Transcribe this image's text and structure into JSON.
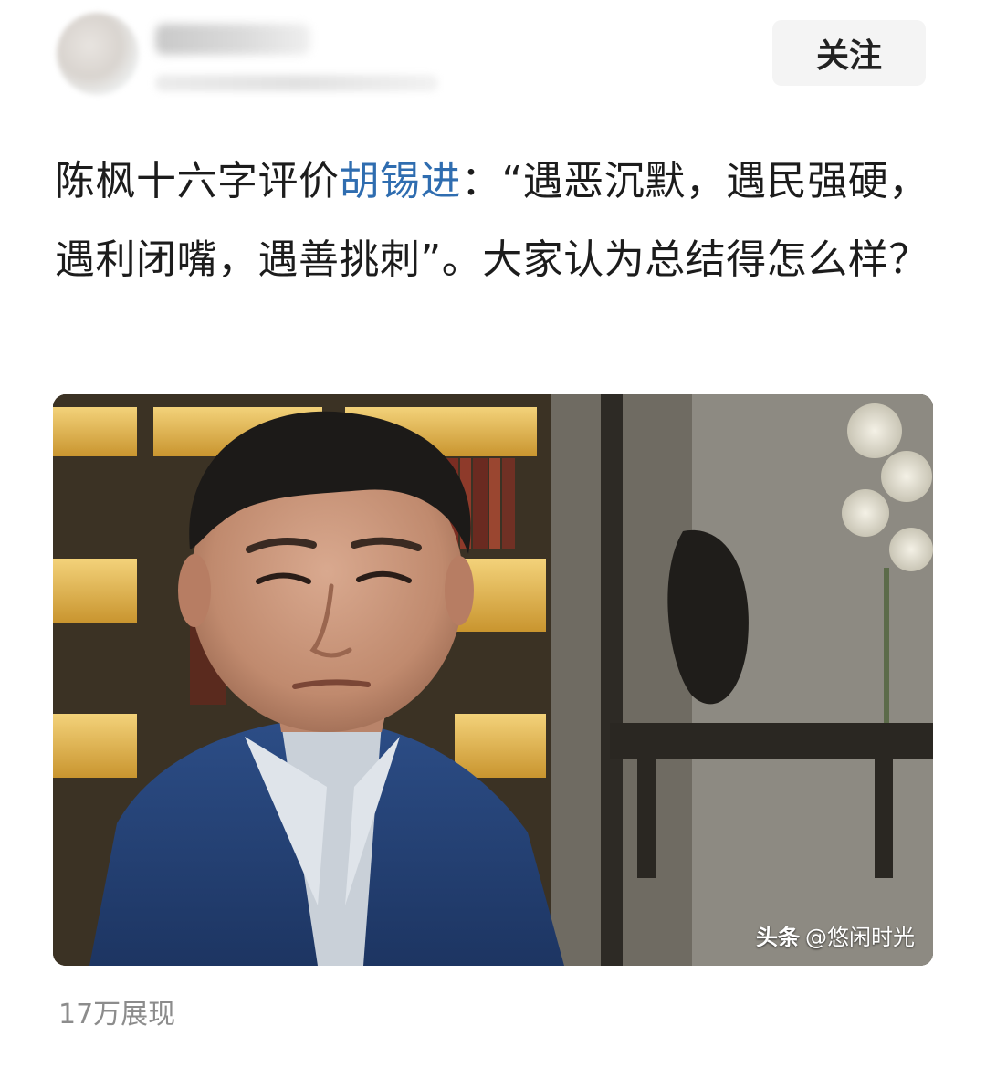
{
  "header": {
    "follow_label": "关注"
  },
  "post": {
    "text_before": "陈枫十六字评价",
    "mention": "胡锡进",
    "text_after": "：“遇恶沉默，遇民强硬，遇利闭嘴，遇善挑刺”。大家认为总结得怎么样？"
  },
  "media": {
    "watermark_brand": "头条",
    "watermark_handle": "@悠闲时光"
  },
  "footer": {
    "view_count": "17万展现"
  },
  "colors": {
    "mention": "#2f6db0",
    "follow_bg": "#f4f4f4",
    "meta_text": "#8c8c8c"
  }
}
